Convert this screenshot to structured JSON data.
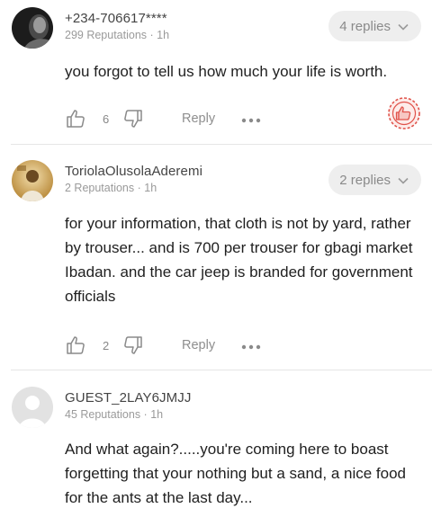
{
  "comments": [
    {
      "author": "+234-706617****",
      "meta": "299 Reputations · 1h",
      "replies": "4 replies",
      "text": "you forgot to tell us how much your life is worth.",
      "likes": "6",
      "reply_label": "Reply",
      "avatar": "dark-photo"
    },
    {
      "author": "ToriolaOlusolaAderemi",
      "meta": "2 Reputations · 1h",
      "replies": "2 replies",
      "text": "for your information, that cloth is not by yard, rather by trouser... and is 700 per trouser for gbagi market Ibadan. and the car jeep is branded for government officials",
      "likes": "2",
      "reply_label": "Reply",
      "avatar": "golden-photo"
    },
    {
      "author": "GUEST_2LAY6JMJJ",
      "meta": "45 Reputations · 1h",
      "text": "And what again?.....you're coming here to boast forgetting that your nothing but a sand, a nice food for the ants at the last day...",
      "avatar": "default-avatar"
    }
  ],
  "colors": {
    "accent_red": "#e0524a",
    "pill_bg": "#eeeeee",
    "muted": "#9a9a9a"
  },
  "icons": [
    "thumbs-up-icon",
    "thumbs-down-icon",
    "more-dots-icon",
    "chevron-down-icon",
    "like-badge-icon"
  ]
}
